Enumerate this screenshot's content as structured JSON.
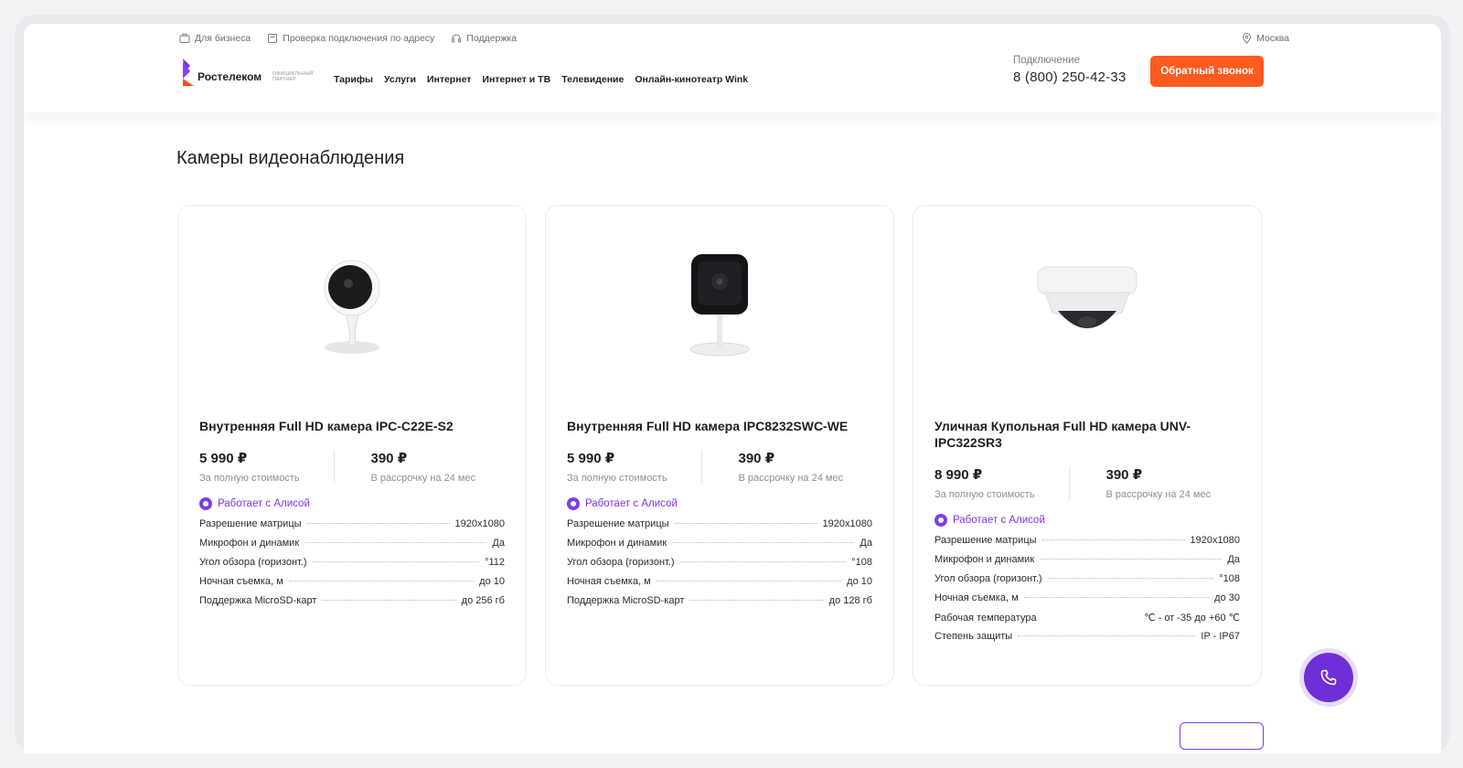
{
  "topbar": {
    "business": "Для бизнеса",
    "check": "Проверка подключения по адресу",
    "support": "Поддержка",
    "city": "Москва"
  },
  "logo": {
    "name": "Ростелеком",
    "sub": "официальный партнер"
  },
  "nav": [
    "Тарифы",
    "Услуги",
    "Интернет",
    "Интернет и ТВ",
    "Телевидение",
    "Онлайн-кинотеатр Wink"
  ],
  "contact": {
    "label": "Подключение",
    "phone": "8 (800) 250-42-33"
  },
  "callback_label": "Обратный звонок",
  "section_title": "Камеры видеонаблюдения",
  "cards": [
    {
      "title": "Внутренняя Full HD камера IPC-C22E-S2",
      "price_full": "5 990 ₽",
      "price_full_note": "За полную стоимость",
      "price_installment": "390 ₽",
      "price_installment_note": "В рассрочку на 24 мес",
      "alice": "Работает с Алисой",
      "specs": [
        {
          "label": "Разрешение матрицы",
          "value": "1920x1080"
        },
        {
          "label": "Микрофон и динамик",
          "value": "Да"
        },
        {
          "label": "Угол обзора (горизонт.)",
          "value": "°112"
        },
        {
          "label": "Ночная съемка, м",
          "value": "до 10"
        },
        {
          "label": "Поддержка MicroSD-карт",
          "value": "до 256 гб"
        }
      ]
    },
    {
      "title": "Внутренняя Full HD камера IPC8232SWC-WE",
      "price_full": "5 990 ₽",
      "price_full_note": "За полную стоимость",
      "price_installment": "390 ₽",
      "price_installment_note": "В рассрочку на 24 мес",
      "alice": "Работает с Алисой",
      "specs": [
        {
          "label": "Разрешение матрицы",
          "value": "1920x1080"
        },
        {
          "label": "Микрофон и динамик",
          "value": "Да"
        },
        {
          "label": "Угол обзора (горизонт.)",
          "value": "°108"
        },
        {
          "label": "Ночная съемка, м",
          "value": "до 10"
        },
        {
          "label": "Поддержка MicroSD-карт",
          "value": "до 128 гб"
        }
      ]
    },
    {
      "title": "Уличная Купольная Full HD камера UNV-IPC322SR3",
      "price_full": "8 990 ₽",
      "price_full_note": "За полную стоимость",
      "price_installment": "390 ₽",
      "price_installment_note": "В рассрочку на 24 мес",
      "alice": "Работает с Алисой",
      "specs": [
        {
          "label": "Разрешение матрицы",
          "value": "1920x1080"
        },
        {
          "label": "Микрофон и динамик",
          "value": "Да"
        },
        {
          "label": "Угол обзора (горизонт.)",
          "value": "°108"
        },
        {
          "label": "Ночная съемка, м",
          "value": "до 30"
        },
        {
          "label": "Рабочая температура",
          "value": "℃ - от -35 до +60 ℃"
        },
        {
          "label": "Степень защиты",
          "value": "IP - IP67"
        }
      ]
    }
  ],
  "colors": {
    "accent_orange": "#ff5a1f",
    "accent_purple": "#7b3fe4"
  }
}
